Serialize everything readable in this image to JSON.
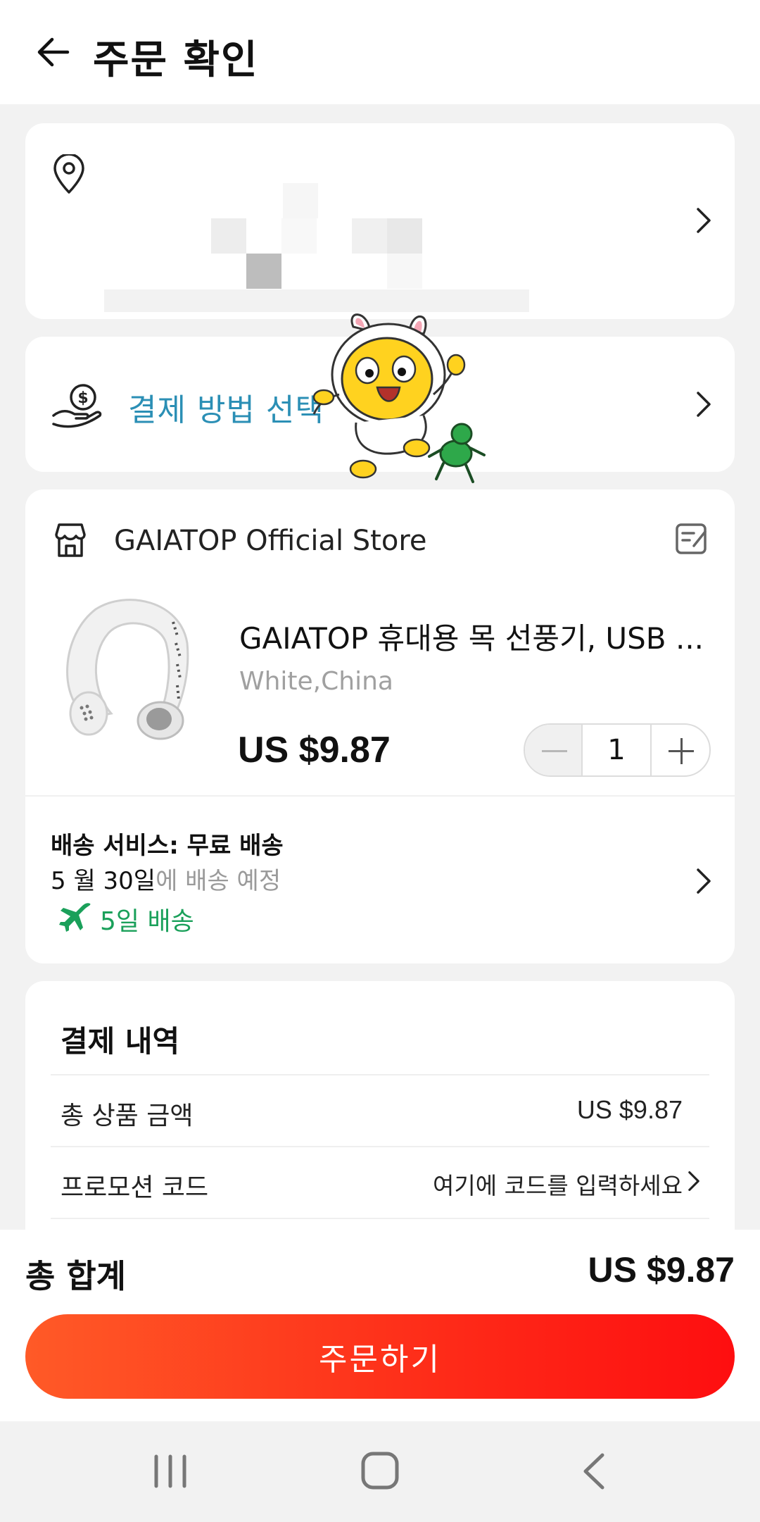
{
  "header": {
    "title": "주문 확인"
  },
  "payment": {
    "label": "결제 방법 선택"
  },
  "store": {
    "name": "GAIATOP Official Store",
    "product": {
      "title": "GAIATOP 휴대용 목 선풍기, USB ...",
      "variant": "White,China",
      "price": "US $9.87",
      "quantity": "1"
    },
    "shipping": {
      "label": "배송 서비스: 무료 배송",
      "date": "5 월 30일",
      "date_suffix": "에 배송 예정",
      "days": "5일 배송"
    }
  },
  "summary": {
    "title": "결제 내역",
    "rows": [
      {
        "label": "총 상품 금액",
        "value": "US $9.87"
      },
      {
        "label": "프로모션 코드",
        "value": "여기에 코드를 입력하세요"
      }
    ]
  },
  "footer": {
    "total_label": "총 합계",
    "total_value": "US $9.87",
    "order_button": "주문하기"
  },
  "colors": {
    "accent_orange": "#ff5a27",
    "accent_red": "#fe0e10",
    "link_blue": "#2b8fb5",
    "shipping_green": "#1aa05a"
  },
  "icons": [
    "back-arrow-icon",
    "location-pin-icon",
    "chevron-right-icon",
    "money-hand-icon",
    "store-icon",
    "edit-note-icon",
    "minus-icon",
    "plus-icon",
    "airplane-icon",
    "nav-recents-icon",
    "nav-home-icon",
    "nav-back-icon"
  ]
}
